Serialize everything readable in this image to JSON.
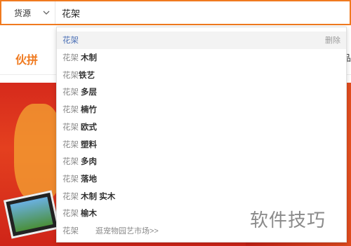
{
  "search": {
    "type_label": "货源",
    "query": "花架"
  },
  "page": {
    "nav_left": "伙拼",
    "nav_right_fragment": "品"
  },
  "dropdown": {
    "delete_label": "删除",
    "items": [
      {
        "keyword": "花架",
        "extra": ""
      },
      {
        "keyword": "花架",
        "extra": "木制"
      },
      {
        "keyword": "花架",
        "extra": "铁艺"
      },
      {
        "keyword": "花架",
        "extra": "多层"
      },
      {
        "keyword": "花架",
        "extra": "楠竹"
      },
      {
        "keyword": "花架",
        "extra": "欧式"
      },
      {
        "keyword": "花架",
        "extra": "塑料"
      },
      {
        "keyword": "花架",
        "extra": "多肉"
      },
      {
        "keyword": "花架",
        "extra": "落地"
      },
      {
        "keyword": "花架",
        "extra": "木制 实木"
      },
      {
        "keyword": "花架",
        "extra": "榆木"
      }
    ],
    "market": {
      "keyword": "花架",
      "text": "逛宠物园艺市场>>"
    }
  },
  "watermark": "软件技巧"
}
